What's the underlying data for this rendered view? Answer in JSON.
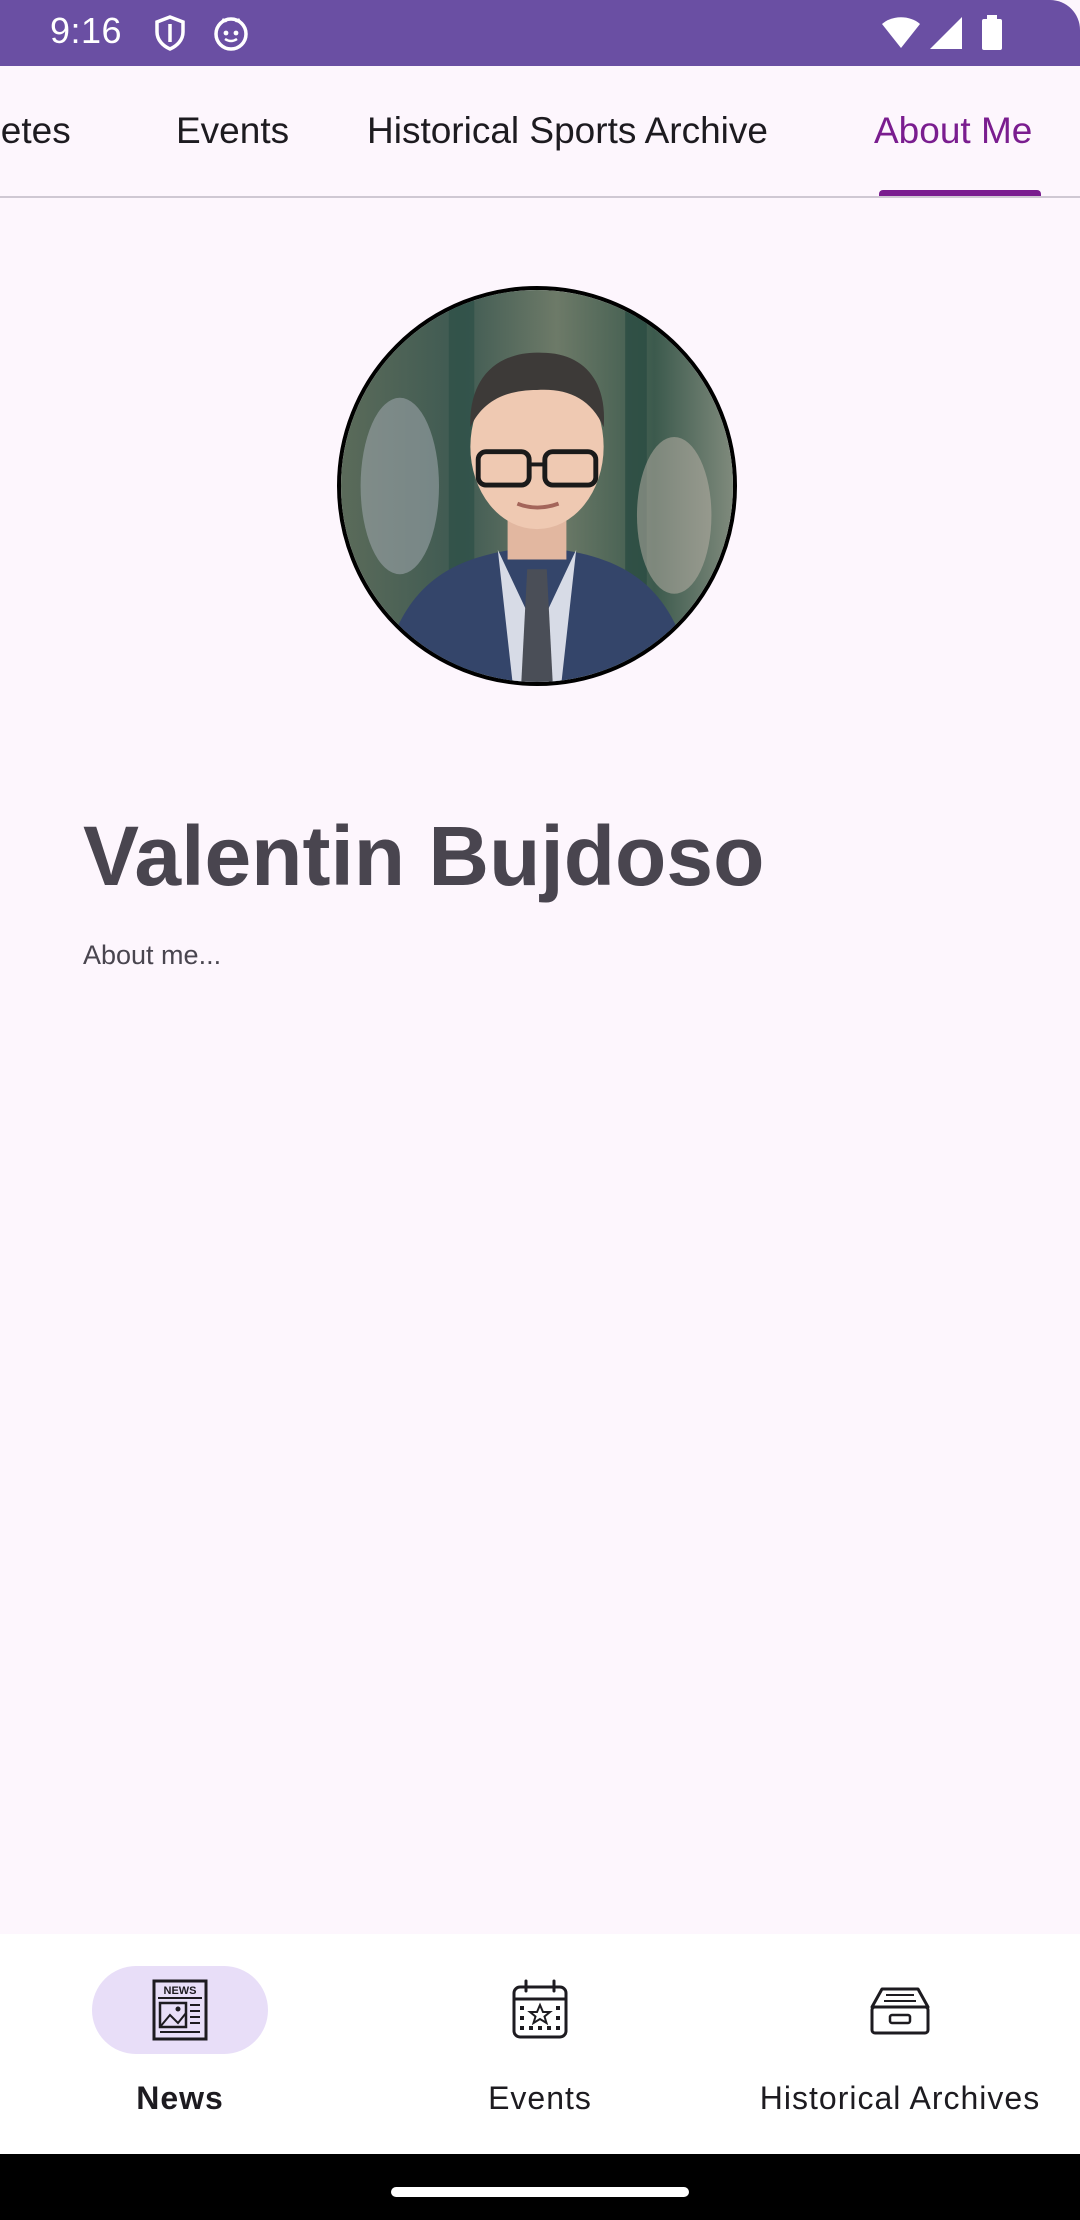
{
  "status_bar": {
    "time": "9:16",
    "icons": [
      "shield-icon",
      "cat-face-icon",
      "wifi-icon",
      "signal-icon",
      "battery-icon"
    ],
    "background": "#6a4fa3"
  },
  "top_tabs": {
    "items": [
      {
        "label": "hletes",
        "icon": null
      },
      {
        "label": "Events",
        "icon": null
      },
      {
        "label": "Historical Sports Archive",
        "icon": null
      },
      {
        "label": "About Me",
        "icon": null
      }
    ],
    "selected": "About Me",
    "accent": "#7a1d8f"
  },
  "profile": {
    "name": "Valentin Bujdoso",
    "about": "About me...",
    "photo_icon": "profile-photo"
  },
  "bottom_nav": {
    "items": [
      {
        "label": "News",
        "icon": "newspaper-icon",
        "selected": true
      },
      {
        "label": "Events",
        "icon": "calendar-star-icon",
        "selected": false
      },
      {
        "label": "Historical Archives",
        "icon": "archive-box-icon",
        "selected": false
      }
    ],
    "pill_color": "#e8def8"
  }
}
